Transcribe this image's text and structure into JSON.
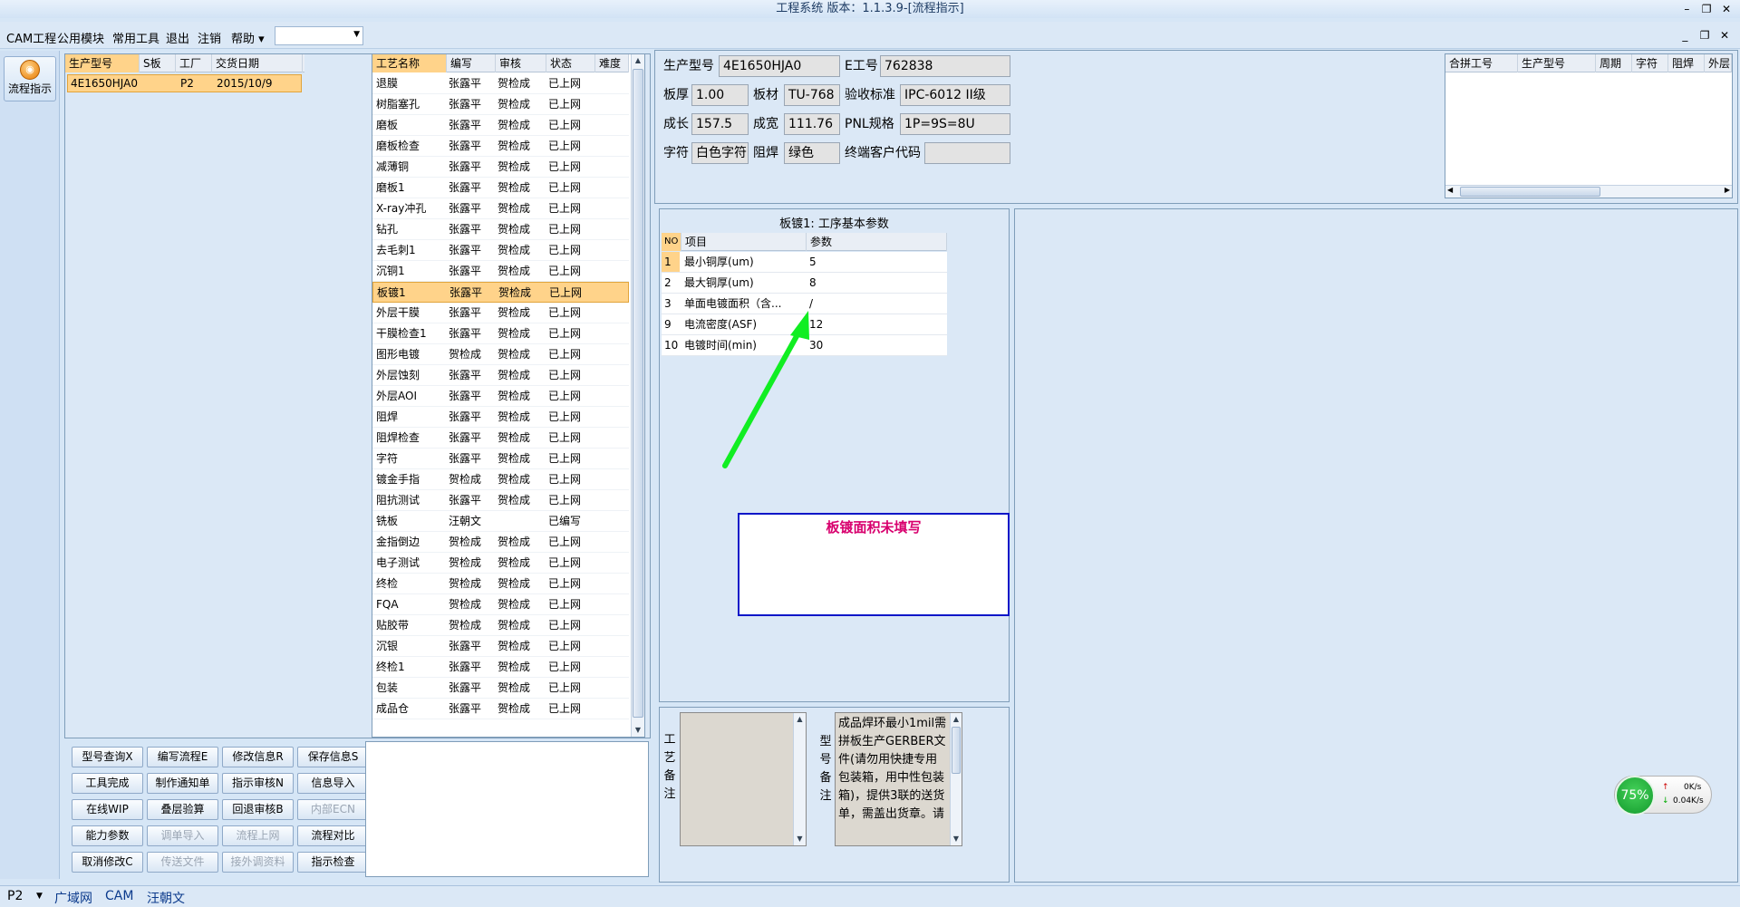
{
  "window": {
    "title": "工程系统 版本：1.1.3.9-[流程指示]",
    "controls": [
      "–",
      "❐",
      "✕"
    ],
    "mdi_controls": [
      "_",
      "❐",
      "✕"
    ]
  },
  "menu": {
    "items": [
      "CAM工程",
      "公用模块",
      "常用工具",
      "退出",
      "注销",
      "帮助 ▾"
    ],
    "combo_value": ""
  },
  "toolstrip": {
    "flow_button": "流程指示"
  },
  "product_grid": {
    "headers": [
      "生产型号",
      "S板",
      "工厂",
      "交货日期"
    ],
    "rows": [
      {
        "model": "4E1650HJA0",
        "s": "",
        "factory": "P2",
        "date": "2015/10/9"
      }
    ]
  },
  "process_grid": {
    "headers": [
      "工艺名称",
      "编写",
      "审核",
      "状态",
      "难度"
    ],
    "rows": [
      [
        "退膜",
        "张露平",
        "贺检成",
        "已上网"
      ],
      [
        "树脂塞孔",
        "张露平",
        "贺检成",
        "已上网"
      ],
      [
        "磨板",
        "张露平",
        "贺检成",
        "已上网"
      ],
      [
        "磨板检查",
        "张露平",
        "贺检成",
        "已上网"
      ],
      [
        "减薄铜",
        "张露平",
        "贺检成",
        "已上网"
      ],
      [
        "磨板1",
        "张露平",
        "贺检成",
        "已上网"
      ],
      [
        "X-ray冲孔",
        "张露平",
        "贺检成",
        "已上网"
      ],
      [
        "钻孔",
        "张露平",
        "贺检成",
        "已上网"
      ],
      [
        "去毛刺1",
        "张露平",
        "贺检成",
        "已上网"
      ],
      [
        "沉铜1",
        "张露平",
        "贺检成",
        "已上网"
      ],
      [
        "板镀1",
        "张露平",
        "贺检成",
        "已上网"
      ],
      [
        "外层干膜",
        "张露平",
        "贺检成",
        "已上网"
      ],
      [
        "干膜检查1",
        "张露平",
        "贺检成",
        "已上网"
      ],
      [
        "图形电镀",
        "贺检成",
        "贺检成",
        "已上网"
      ],
      [
        "外层蚀刻",
        "张露平",
        "贺检成",
        "已上网"
      ],
      [
        "外层AOI",
        "张露平",
        "贺检成",
        "已上网"
      ],
      [
        "阻焊",
        "张露平",
        "贺检成",
        "已上网"
      ],
      [
        "阻焊检查",
        "张露平",
        "贺检成",
        "已上网"
      ],
      [
        "字符",
        "张露平",
        "贺检成",
        "已上网"
      ],
      [
        "镀金手指",
        "贺检成",
        "贺检成",
        "已上网"
      ],
      [
        "阻抗测试",
        "张露平",
        "贺检成",
        "已上网"
      ],
      [
        "铣板",
        "汪朝文",
        "",
        "已编写"
      ],
      [
        "金指倒边",
        "贺检成",
        "贺检成",
        "已上网"
      ],
      [
        "电子测试",
        "贺检成",
        "贺检成",
        "已上网"
      ],
      [
        "终检",
        "贺检成",
        "贺检成",
        "已上网"
      ],
      [
        "FQA",
        "贺检成",
        "贺检成",
        "已上网"
      ],
      [
        "贴胶带",
        "贺检成",
        "贺检成",
        "已上网"
      ],
      [
        "沉银",
        "张露平",
        "贺检成",
        "已上网"
      ],
      [
        "终检1",
        "张露平",
        "贺检成",
        "已上网"
      ],
      [
        "包装",
        "张露平",
        "贺检成",
        "已上网"
      ],
      [
        "成品仓",
        "张露平",
        "贺检成",
        "已上网"
      ]
    ],
    "selected_index": 10
  },
  "buttons": [
    [
      "型号查询X",
      "编写流程E",
      "修改信息R",
      "保存信息S"
    ],
    [
      "工具完成",
      "制作通知单",
      "指示审核N",
      "信息导入"
    ],
    [
      "在线WIP",
      "叠层验算",
      "回退审核B",
      "内部ECN"
    ],
    [
      "能力参数",
      "调单导入",
      "流程上网",
      "流程对比"
    ],
    [
      "取消修改C",
      "传送文件",
      "接外调资料",
      "指示检查"
    ]
  ],
  "disabled_buttons": [
    "内部ECN",
    "调单导入",
    "流程上网",
    "传送文件",
    "接外调资料"
  ],
  "info": {
    "labels": {
      "model": "生产型号",
      "e_no": "E工号",
      "thickness": "板厚",
      "material": "板材",
      "standard": "验收标准",
      "length": "成长",
      "width": "成宽",
      "pnl": "PNL规格",
      "silkscreen": "字符",
      "mask": "阻焊",
      "end_customer": "终端客户代码"
    },
    "values": {
      "model": "4E1650HJA0",
      "e_no": "762838",
      "thickness": "1.00",
      "material": "TU-768",
      "standard": "IPC-6012 II级",
      "length": "157.5",
      "width": "111.76",
      "pnl": "1P=9S=8U",
      "silkscreen": "白色字符",
      "mask": "绿色",
      "end_customer": ""
    }
  },
  "merge_grid": {
    "headers": [
      "合拼工号",
      "生产型号",
      "周期",
      "字符",
      "阻焊",
      "外层"
    ]
  },
  "params": {
    "title": "板镀1: 工序基本参数",
    "headers": [
      "NO",
      "项目",
      "参数"
    ],
    "rows": [
      [
        "1",
        "最小铜厚(um)",
        "5"
      ],
      [
        "2",
        "最大铜厚(um)",
        "8"
      ],
      [
        "3",
        "单面电镀面积（含...",
        "/"
      ],
      [
        "9",
        "电流密度(ASF)",
        "12"
      ],
      [
        "10",
        "电镀时间(min)",
        "30"
      ]
    ]
  },
  "annotation": {
    "text": "板镀面积未填写",
    "arrow_color": "#11ee22",
    "box_color": "#0a16c8",
    "text_color": "#d8006e"
  },
  "remarks": {
    "process_label": "工艺备注",
    "model_label": "型号备注",
    "process_text": "",
    "model_text": "成品焊环最小1mil需拼板生产GERBER文件(请勿用快捷专用包装箱，用中性包装箱)，提供3联的送货单，需盖出货章。请"
  },
  "statusbar": {
    "factory": "P2",
    "network": "广域网",
    "module": "CAM",
    "user": "汪朝文"
  },
  "net_widget": {
    "percent": "75%",
    "up": "0K/s",
    "down": "0.04K/s"
  }
}
